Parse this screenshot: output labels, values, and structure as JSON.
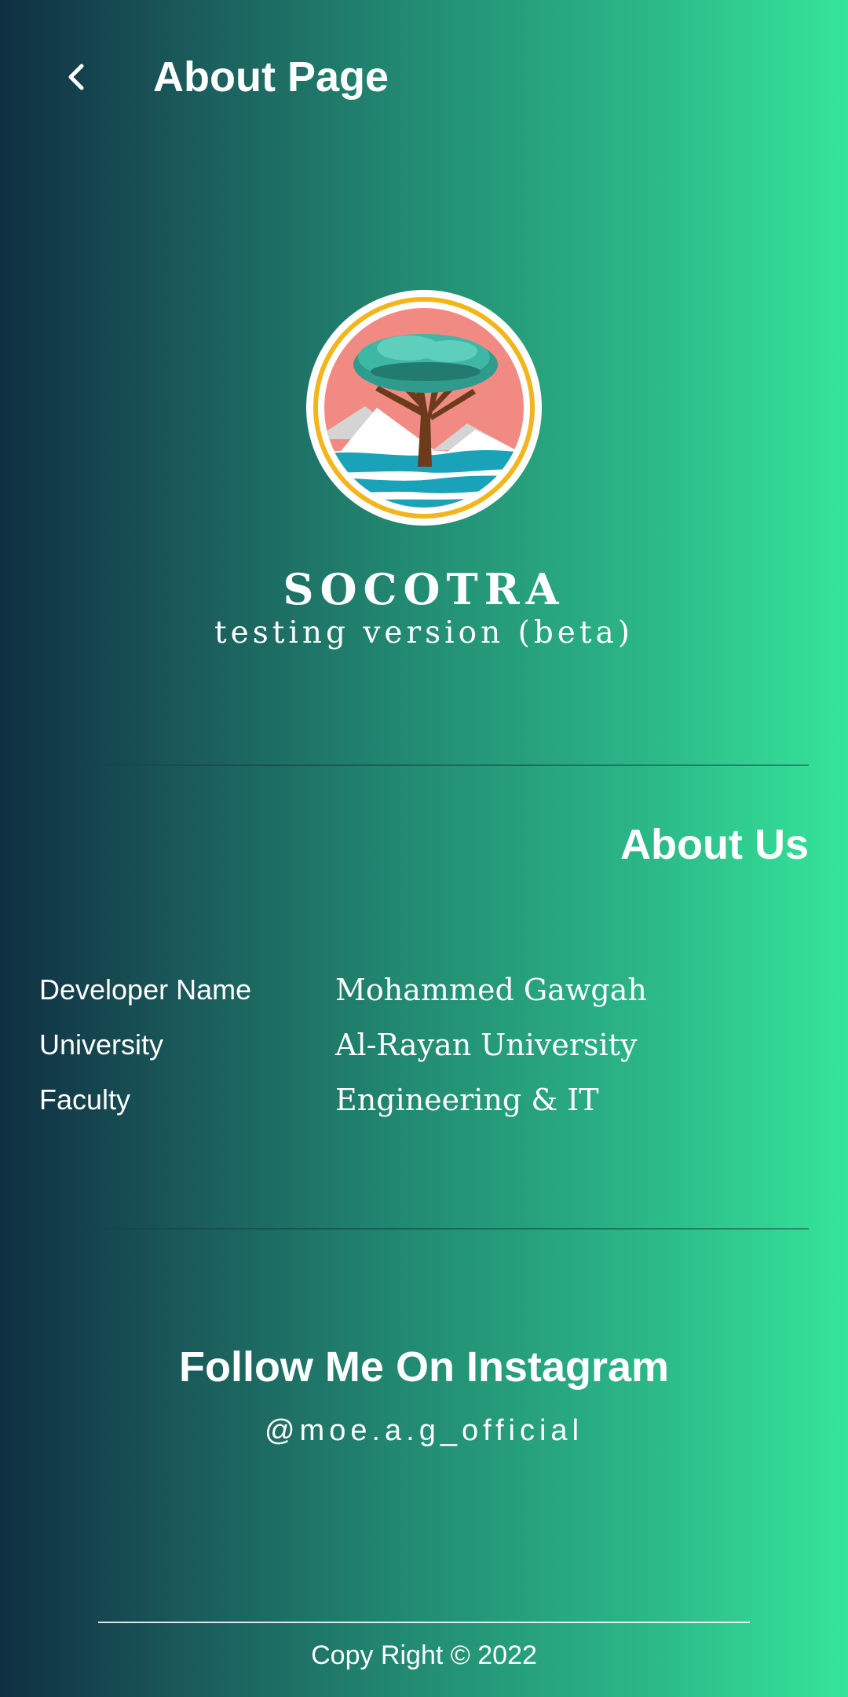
{
  "app_bar": {
    "back_icon": "chevron-left-icon",
    "title": "About Page"
  },
  "branding": {
    "logo": "socotra-dragon-tree-logo",
    "app_name": "SOCOTRA",
    "version": "testing version (beta)"
  },
  "about": {
    "title": "About Us",
    "rows": [
      {
        "label": "Developer Name",
        "value": "Mohammed Gawgah"
      },
      {
        "label": "University",
        "value": "Al-Rayan University"
      },
      {
        "label": "Faculty",
        "value": "Engineering & IT"
      }
    ]
  },
  "social": {
    "title": "Follow Me On Instagram",
    "handle": "@moe.a.g_official"
  },
  "footer": {
    "copyright": "Copy Right © 2022"
  },
  "colors": {
    "gradient_start": "#0f2f42",
    "gradient_end": "#35e59a",
    "logo_ring": "#f2b61c",
    "logo_sky": "#f28a84",
    "logo_tree_canopy": "#3fb7a5",
    "logo_trunk": "#6b3b1c",
    "logo_water": "#1aa3b8"
  }
}
